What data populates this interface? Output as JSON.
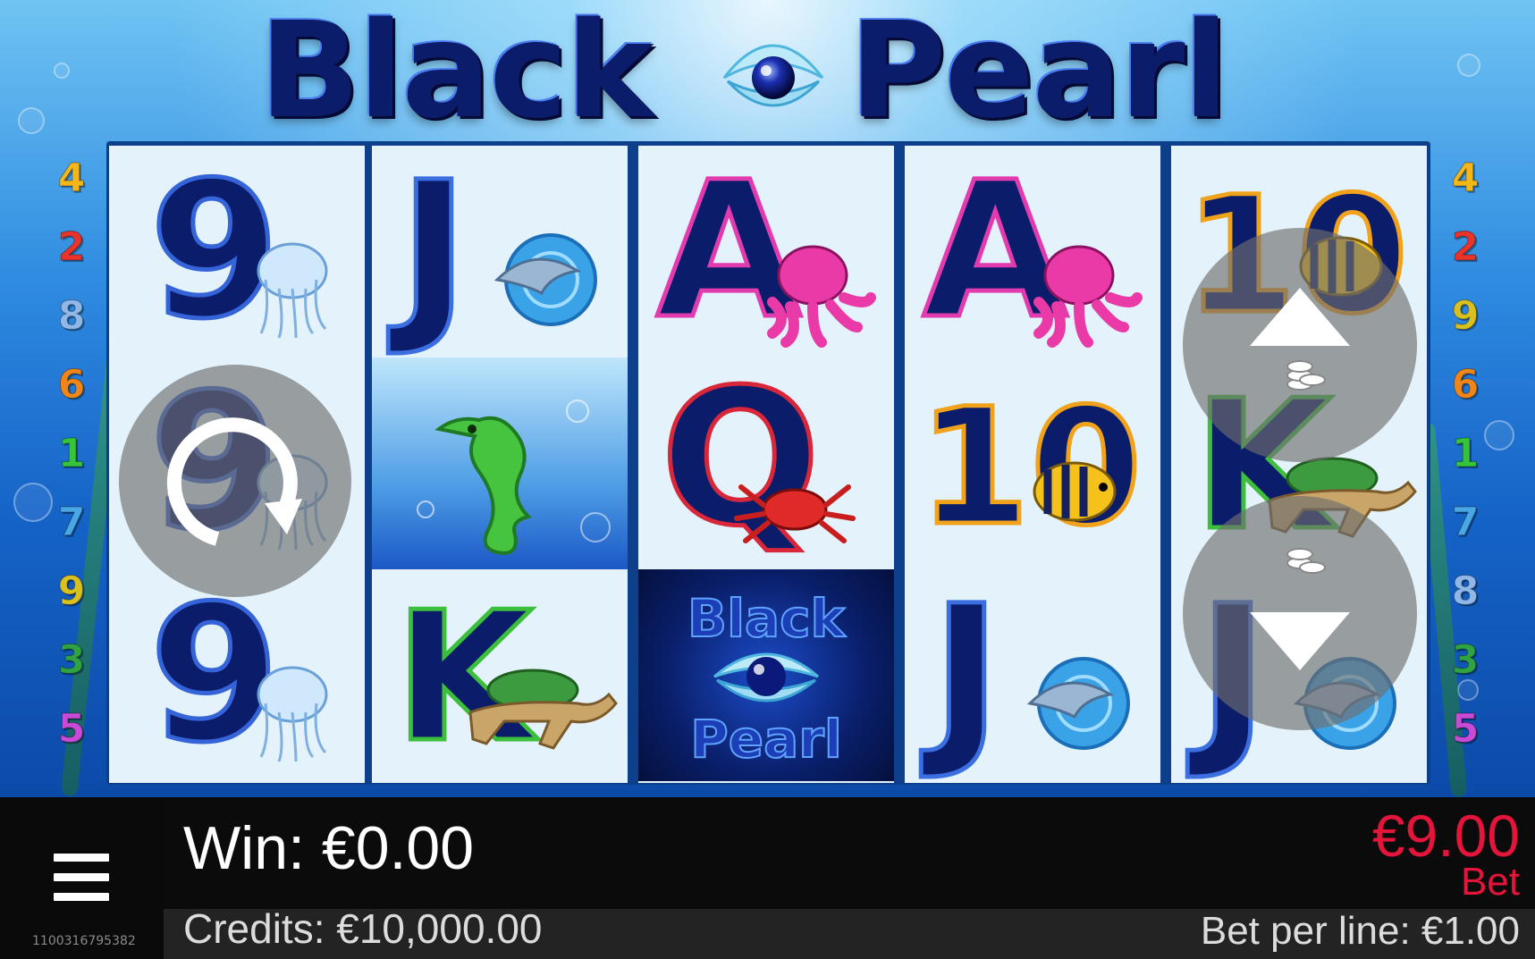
{
  "game": {
    "title_part1": "Black",
    "title_part2": "Pearl"
  },
  "paylines": {
    "left": [
      "4",
      "2",
      "8",
      "6",
      "1",
      "7",
      "9",
      "3",
      "5"
    ],
    "right": [
      "4",
      "2",
      "9",
      "6",
      "1",
      "7",
      "8",
      "3",
      "5"
    ]
  },
  "reels": [
    [
      "9-jellyfish",
      "9-jellyfish",
      "9-jellyfish"
    ],
    [
      "J-dolphin",
      "seahorse",
      "K-turtle"
    ],
    [
      "A-octopus",
      "Q-crab",
      "black-pearl-wild"
    ],
    [
      "A-octopus",
      "10-fish",
      "J-dolphin"
    ],
    [
      "10-fish",
      "K-turtle",
      "J-dolphin"
    ]
  ],
  "reel_symbols": {
    "wild_line1": "Black",
    "wild_line2": "Pearl"
  },
  "controls": {
    "spin_icon": "autospin-icon",
    "bet_up_icon": "bet-increase-icon",
    "bet_down_icon": "bet-decrease-icon",
    "menu_icon": "menu-icon"
  },
  "status": {
    "win": "Win: €0.00",
    "credits": "Credits: €10,000.00",
    "bet_amount": "€9.00",
    "bet_label": "Bet",
    "bet_per_line": "Bet per line: €1.00",
    "game_id": "1100316795382"
  },
  "colors": {
    "bet": "#e4143a",
    "bar_bg": "#232323",
    "reel_bg": "#e4f3fb",
    "line_colors": {
      "1": "#35c43a",
      "2": "#e8342a",
      "3": "#2fa341",
      "4": "#f4b71a",
      "5": "#c94ad6",
      "6": "#f0861a",
      "7": "#49a7e6",
      "8": "#8fb7e8",
      "9": "#d8c020"
    }
  }
}
